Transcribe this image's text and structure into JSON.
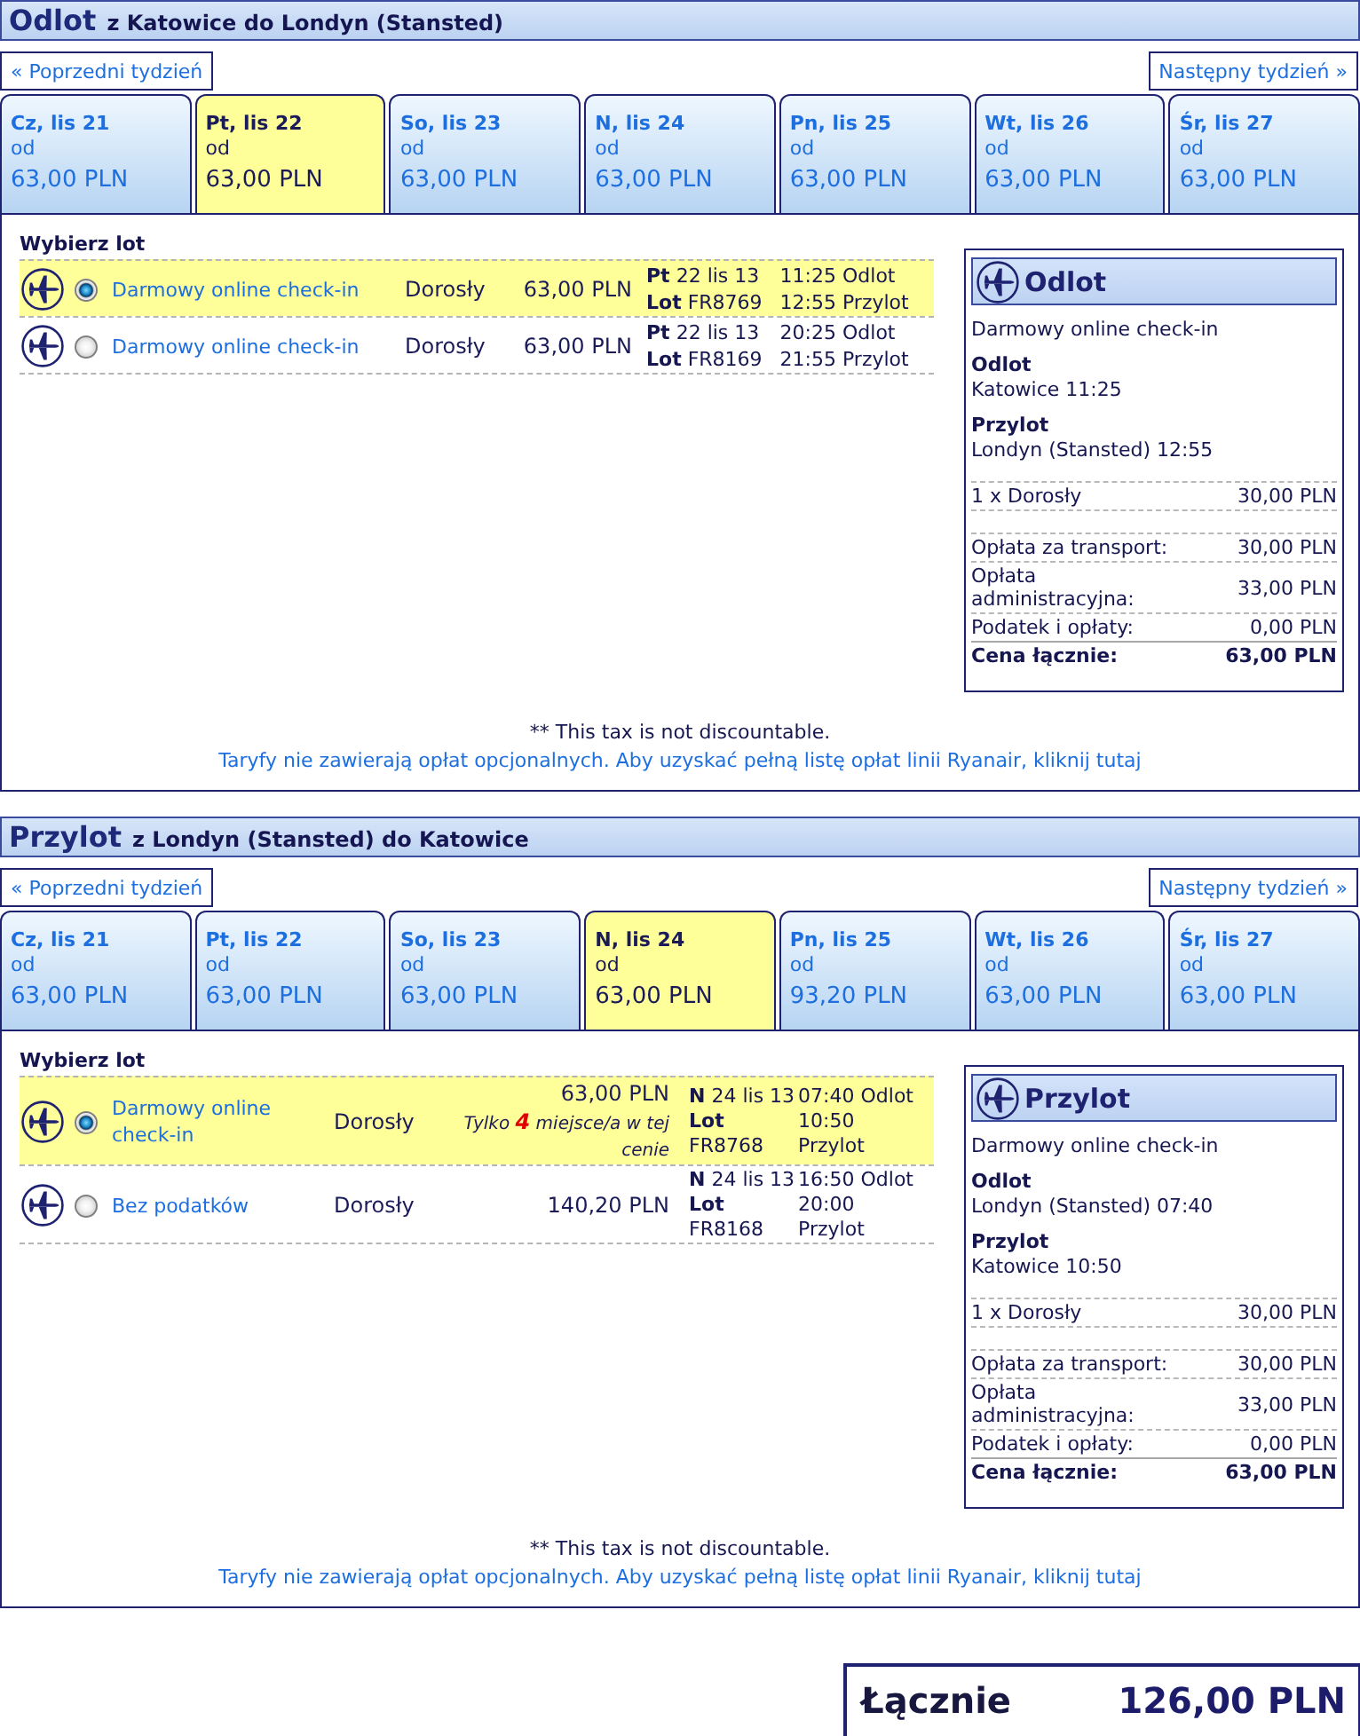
{
  "sections": [
    {
      "title": "Odlot",
      "route": "z Katowice do Londyn (Stansted)",
      "prev_week": "« Poprzedni tydzień",
      "next_week": "Następny tydzień »",
      "dates": [
        {
          "day": "Cz, lis 21",
          "from": "od",
          "price": "63,00 PLN",
          "selected": false
        },
        {
          "day": "Pt, lis 22",
          "from": "od",
          "price": "63,00 PLN",
          "selected": true
        },
        {
          "day": "So, lis 23",
          "from": "od",
          "price": "63,00 PLN",
          "selected": false
        },
        {
          "day": "N, lis 24",
          "from": "od",
          "price": "63,00 PLN",
          "selected": false
        },
        {
          "day": "Pn, lis 25",
          "from": "od",
          "price": "63,00 PLN",
          "selected": false
        },
        {
          "day": "Wt, lis 26",
          "from": "od",
          "price": "63,00 PLN",
          "selected": false
        },
        {
          "day": "Śr, lis 27",
          "from": "od",
          "price": "63,00 PLN",
          "selected": false
        }
      ],
      "choose_label": "Wybierz lot",
      "flights": [
        {
          "fare": "Darmowy online check-in",
          "passenger": "Dorosły",
          "price": "63,00 PLN",
          "date_line": "**Pt** 22 lis 13",
          "flight_line": "**Lot** FR8769",
          "departure": "11:25 Odlot",
          "arrival": "12:55 Przylot",
          "selected": true
        },
        {
          "fare": "Darmowy online check-in",
          "passenger": "Dorosły",
          "price": "63,00 PLN",
          "date_line": "**Pt** 22 lis 13",
          "flight_line": "**Lot** FR8169",
          "departure": "20:25 Odlot",
          "arrival": "21:55 Przylot",
          "selected": false
        }
      ],
      "summary": {
        "title": "Odlot",
        "fare": "Darmowy online check-in",
        "departure": {
          "label": "Odlot",
          "value": "Katowice 11:25"
        },
        "arrival": {
          "label": "Przylot",
          "value": "Londyn (Stansted) 12:55"
        },
        "passengers": [
          {
            "label": "1 x Dorosły",
            "amount": "30,00 PLN"
          }
        ],
        "fees": [
          {
            "label": "Opłata za transport:",
            "amount": "30,00 PLN"
          },
          {
            "label": "Opłata administracyjna:",
            "amount": "33,00 PLN"
          },
          {
            "label": "Podatek i opłaty:",
            "amount": "0,00 PLN"
          }
        ],
        "total": {
          "label": "Cena łącznie:",
          "amount": "63,00 PLN"
        }
      },
      "tax_note": "** This tax is not discountable.",
      "fees_link": "Taryfy nie zawierają opłat opcjonalnych. Aby uzyskać pełną listę opłat linii Ryanair, kliknij tutaj"
    },
    {
      "title": "Przylot",
      "route": "z Londyn (Stansted) do Katowice",
      "prev_week": "« Poprzedni tydzień",
      "next_week": "Następny tydzień »",
      "dates": [
        {
          "day": "Cz, lis 21",
          "from": "od",
          "price": "63,00 PLN",
          "selected": false
        },
        {
          "day": "Pt, lis 22",
          "from": "od",
          "price": "63,00 PLN",
          "selected": false
        },
        {
          "day": "So, lis 23",
          "from": "od",
          "price": "63,00 PLN",
          "selected": false
        },
        {
          "day": "N, lis 24",
          "from": "od",
          "price": "63,00 PLN",
          "selected": true
        },
        {
          "day": "Pn, lis 25",
          "from": "od",
          "price": "93,20 PLN",
          "selected": false
        },
        {
          "day": "Wt, lis 26",
          "from": "od",
          "price": "63,00 PLN",
          "selected": false
        },
        {
          "day": "Śr, lis 27",
          "from": "od",
          "price": "63,00 PLN",
          "selected": false
        }
      ],
      "choose_label": "Wybierz lot",
      "flights": [
        {
          "fare": "Darmowy online check-in",
          "passenger": "Dorosły",
          "price": "63,00 PLN",
          "note": "Tylko **4** miejsce/a w tej cenie",
          "date_line": "**N** 24 lis 13",
          "flight_line": "**Lot** FR8768",
          "departure": "07:40 Odlot",
          "arrival": "10:50 Przylot",
          "selected": true
        },
        {
          "fare": "Bez podatków",
          "passenger": "Dorosły",
          "price": "140,20 PLN",
          "date_line": "**N** 24 lis 13",
          "flight_line": "**Lot** FR8168",
          "departure": "16:50 Odlot",
          "arrival": "20:00 Przylot",
          "selected": false
        }
      ],
      "summary": {
        "title": "Przylot",
        "fare": "Darmowy online check-in",
        "departure": {
          "label": "Odlot",
          "value": "Londyn (Stansted) 07:40"
        },
        "arrival": {
          "label": "Przylot",
          "value": "Katowice 10:50"
        },
        "passengers": [
          {
            "label": "1 x Dorosły",
            "amount": "30,00 PLN"
          }
        ],
        "fees": [
          {
            "label": "Opłata za transport:",
            "amount": "30,00 PLN"
          },
          {
            "label": "Opłata administracyjna:",
            "amount": "33,00 PLN"
          },
          {
            "label": "Podatek i opłaty:",
            "amount": "0,00 PLN"
          }
        ],
        "total": {
          "label": "Cena łącznie:",
          "amount": "63,00 PLN"
        }
      },
      "tax_note": "** This tax is not discountable.",
      "fees_link": "Taryfy nie zawierają opłat opcjonalnych. Aby uzyskać pełną listę opłat linii Ryanair, kliknij tutaj"
    }
  ],
  "total": {
    "label": "Łącznie",
    "amount": "126,00 PLN"
  }
}
